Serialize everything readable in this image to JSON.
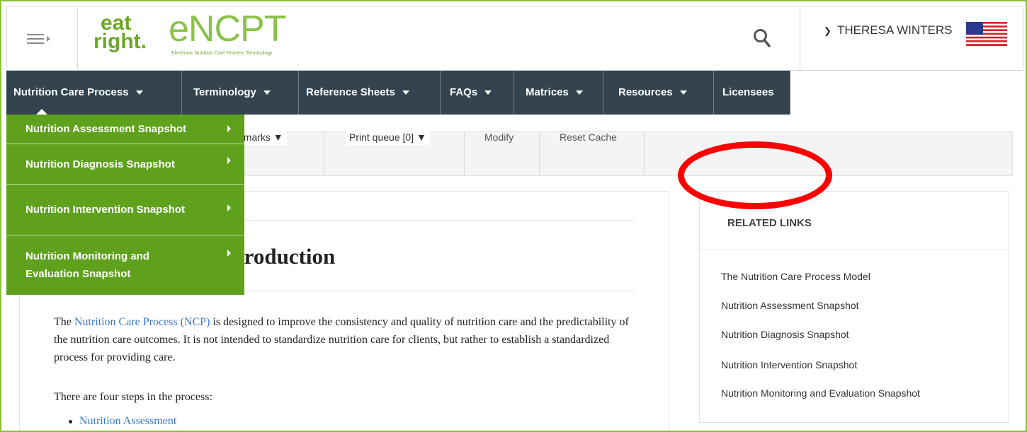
{
  "header": {
    "logo": {
      "eat": "eat",
      "right": "right.",
      "product": "eNCPT",
      "subtitle": "Electronic Nutrition Care Process Terminology"
    },
    "user_name": "THERESA WINTERS",
    "icons": {
      "menu": "hamburger-icon",
      "search": "search-icon",
      "flag": "us-flag-icon",
      "chevron": "chevron-down-icon"
    }
  },
  "nav": {
    "items": [
      {
        "label": "Nutrition Care Process",
        "has_caret": true
      },
      {
        "label": "Terminology",
        "has_caret": true
      },
      {
        "label": "Reference Sheets",
        "has_caret": true
      },
      {
        "label": "FAQs",
        "has_caret": true
      },
      {
        "label": "Matrices",
        "has_caret": true
      },
      {
        "label": "Resources",
        "has_caret": true
      },
      {
        "label": "Licensees",
        "has_caret": false
      }
    ]
  },
  "dropdown": {
    "items": [
      {
        "label": "Nutrition Assessment Snapshot"
      },
      {
        "label": "Nutrition Diagnosis Snapshot"
      },
      {
        "label": "Nutrition Intervention Snapshot"
      },
      {
        "label": "Nutrition Monitoring and Evaluation Snapshot"
      }
    ]
  },
  "toolbar": {
    "bookmarks": "okmarks ▼",
    "print_queue": "Print queue [0] ▼",
    "modify": "Modify",
    "reset_cache": "Reset Cache"
  },
  "main": {
    "title": "Process Introduction",
    "intro_pre": "The ",
    "intro_link": "Nutrition Care Process (NCP)",
    "intro_post": " is designed to improve the consistency and quality of nutrition care and the predictability of the nutrition care outcomes. It is not intended to standardize nutrition care for clients, but rather to establish a standardized process for providing care.",
    "steps_lead": "There are four steps in the process:",
    "steps": [
      "Nutrition Assessment"
    ]
  },
  "related": {
    "title": "RELATED LINKS",
    "links": [
      "The Nutrition Care Process Model",
      "Nutrition Assessment Snapshot",
      "Nutrition Diagnosis Snapshot",
      "Nutrition Intervention Snapshot",
      "Nutrition Monitoring and Evaluation Snapshot"
    ]
  },
  "colors": {
    "brand_green": "#6ea62b",
    "nav_bg": "#33444f",
    "dropdown_bg": "#5fa11d",
    "link": "#3a78c4",
    "annotation": "#ff0000"
  }
}
